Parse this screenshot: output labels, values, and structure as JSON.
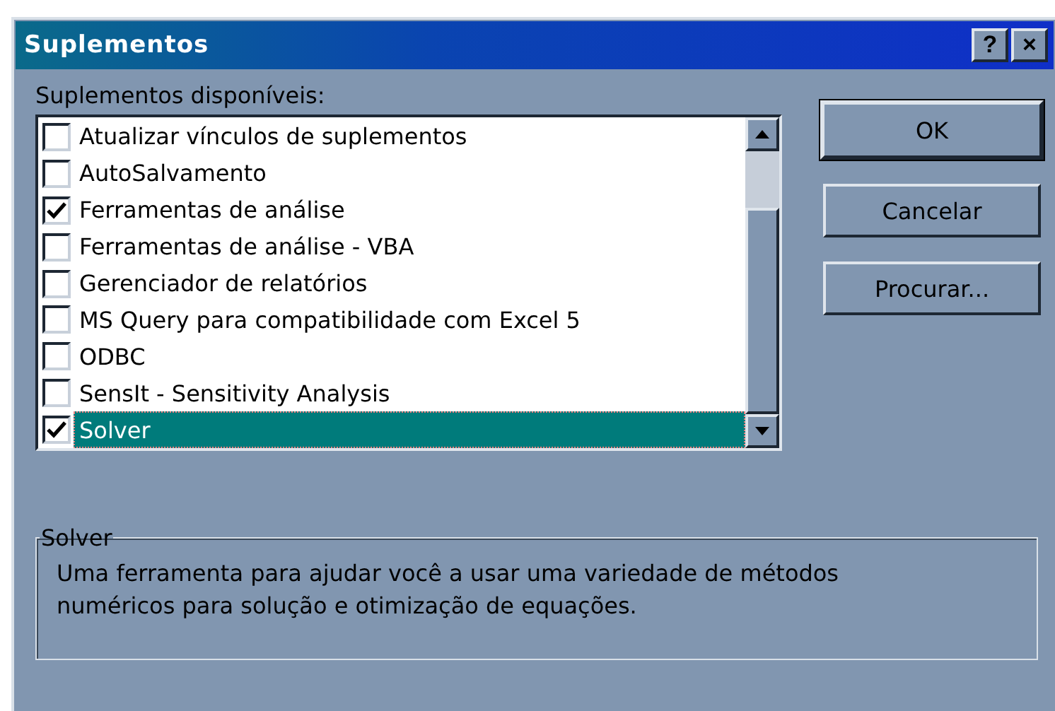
{
  "window": {
    "title": "Suplementos",
    "title_buttons": [
      "?",
      "×"
    ]
  },
  "list": {
    "label": "Suplementos disponíveis:",
    "items": [
      {
        "label": "Atualizar vínculos de suplementos",
        "checked": false,
        "selected": false
      },
      {
        "label": "AutoSalvamento",
        "checked": false,
        "selected": false
      },
      {
        "label": "Ferramentas de análise",
        "checked": true,
        "selected": false
      },
      {
        "label": "Ferramentas de análise - VBA",
        "checked": false,
        "selected": false
      },
      {
        "label": "Gerenciador de relatórios",
        "checked": false,
        "selected": false
      },
      {
        "label": "MS Query para compatibilidade com Excel 5",
        "checked": false,
        "selected": false
      },
      {
        "label": "ODBC",
        "checked": false,
        "selected": false
      },
      {
        "label": "SensIt - Sensitivity Analysis",
        "checked": false,
        "selected": false
      },
      {
        "label": "Solver",
        "checked": true,
        "selected": true
      }
    ]
  },
  "buttons": [
    {
      "label": "OK",
      "default": true
    },
    {
      "label": "Cancelar",
      "default": false
    },
    {
      "label": "Procurar...",
      "default": false
    }
  ],
  "description": {
    "title": "Solver",
    "text": "Uma ferramenta para ajudar você a usar uma variedade de métodos numéricos para solução e otimização de equações."
  }
}
